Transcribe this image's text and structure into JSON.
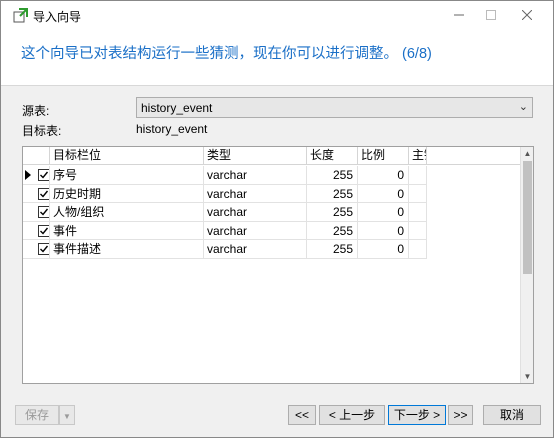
{
  "window": {
    "title": "导入向导",
    "accent": "#1a6fc7"
  },
  "header": {
    "instruction": "这个向导已对表结构运行一些猜测，现在你可以进行调整。 (6/8)"
  },
  "form": {
    "source_label": "源表:",
    "source_value": "history_event",
    "target_label": "目标表:",
    "target_value": "history_event"
  },
  "grid": {
    "columns": [
      "目标栏位",
      "类型",
      "长度",
      "比例",
      "主键"
    ],
    "rows": [
      {
        "checked": true,
        "name": "序号",
        "type": "varchar",
        "length": "255",
        "scale": "0",
        "current": true
      },
      {
        "checked": true,
        "name": "历史时期",
        "type": "varchar",
        "length": "255",
        "scale": "0",
        "current": false
      },
      {
        "checked": true,
        "name": "人物/组织",
        "type": "varchar",
        "length": "255",
        "scale": "0",
        "current": false
      },
      {
        "checked": true,
        "name": "事件",
        "type": "varchar",
        "length": "255",
        "scale": "0",
        "current": false
      },
      {
        "checked": true,
        "name": "事件描述",
        "type": "varchar",
        "length": "255",
        "scale": "0",
        "current": false
      }
    ]
  },
  "footer": {
    "save_label": "保存",
    "first_label": "<<",
    "prev_label": "< 上一步",
    "next_label": "下一步 >",
    "last_label": ">>",
    "cancel_label": "取消"
  },
  "icons": {
    "app": "import-wizard-icon",
    "minimize": "minimize-icon",
    "maximize": "maximize-icon",
    "close": "close-icon"
  }
}
